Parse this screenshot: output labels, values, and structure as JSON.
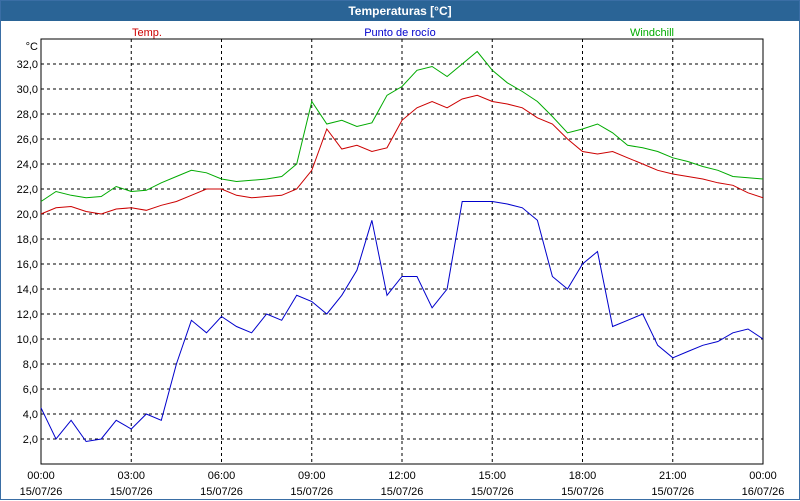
{
  "window": {
    "title": "Temperaturas [°C]"
  },
  "chart_data": {
    "type": "line",
    "unit_label": "°C",
    "ylim": [
      0,
      34
    ],
    "y_ticks": [
      "2,0",
      "4,0",
      "6,0",
      "8,0",
      "10,0",
      "12,0",
      "14,0",
      "16,0",
      "18,0",
      "20,0",
      "22,0",
      "24,0",
      "26,0",
      "28,0",
      "30,0",
      "32,0"
    ],
    "x_ticks": [
      {
        "time": "00:00",
        "date": "15/07/26"
      },
      {
        "time": "03:00",
        "date": "15/07/26"
      },
      {
        "time": "06:00",
        "date": "15/07/26"
      },
      {
        "time": "09:00",
        "date": "15/07/26"
      },
      {
        "time": "12:00",
        "date": "15/07/26"
      },
      {
        "time": "15:00",
        "date": "15/07/26"
      },
      {
        "time": "18:00",
        "date": "15/07/26"
      },
      {
        "time": "21:00",
        "date": "15/07/26"
      },
      {
        "time": "00:00",
        "date": "16/07/26"
      }
    ],
    "grid": true,
    "x": [
      0,
      0.5,
      1,
      1.5,
      2,
      2.5,
      3,
      3.5,
      4,
      4.5,
      5,
      5.5,
      6,
      6.5,
      7,
      7.5,
      8,
      8.5,
      9,
      9.5,
      10,
      10.5,
      11,
      11.5,
      12,
      12.5,
      13,
      13.5,
      14,
      14.5,
      15,
      15.5,
      16,
      16.5,
      17,
      17.5,
      18,
      18.5,
      19,
      19.5,
      20,
      20.5,
      21,
      21.5,
      22,
      22.5,
      23,
      23.5,
      24
    ],
    "series": [
      {
        "name": "Temp.",
        "color": "#cc0000",
        "values": [
          20.0,
          20.5,
          20.6,
          20.2,
          20.0,
          20.4,
          20.5,
          20.3,
          20.7,
          21.0,
          21.5,
          22.0,
          22.0,
          21.5,
          21.3,
          21.4,
          21.5,
          22.0,
          23.5,
          26.8,
          25.2,
          25.5,
          25.0,
          25.3,
          27.5,
          28.5,
          29.0,
          28.5,
          29.2,
          29.5,
          29.0,
          28.8,
          28.5,
          27.7,
          27.2,
          26.0,
          25.0,
          24.8,
          25.0,
          24.5,
          24.0,
          23.5,
          23.2,
          23.0,
          22.8,
          22.5,
          22.3,
          21.7,
          21.3
        ]
      },
      {
        "name": "Punto de rocío",
        "color": "#0000cc",
        "values": [
          4.5,
          2.0,
          3.5,
          1.8,
          2.0,
          3.5,
          2.8,
          4.0,
          3.5,
          8.0,
          11.5,
          10.5,
          11.8,
          11.0,
          10.5,
          12.0,
          11.5,
          13.5,
          13.0,
          12.0,
          13.5,
          15.5,
          19.5,
          13.5,
          15.0,
          15.0,
          12.5,
          14.0,
          21.0,
          21.0,
          21.0,
          20.8,
          20.5,
          19.5,
          15.0,
          14.0,
          16.0,
          17.0,
          11.0,
          11.5,
          12.0,
          9.5,
          8.5,
          9.0,
          9.5,
          9.8,
          10.5,
          10.8,
          10.0
        ]
      },
      {
        "name": "Windchill",
        "color": "#00aa00",
        "values": [
          21.0,
          21.8,
          21.5,
          21.3,
          21.4,
          22.2,
          21.8,
          21.9,
          22.5,
          23.0,
          23.5,
          23.3,
          22.8,
          22.6,
          22.7,
          22.8,
          23.0,
          24.0,
          29.0,
          27.2,
          27.5,
          27.0,
          27.3,
          29.5,
          30.2,
          31.5,
          31.8,
          31.0,
          32.0,
          33.0,
          31.5,
          30.5,
          29.8,
          29.0,
          27.8,
          26.5,
          26.8,
          27.2,
          26.5,
          25.5,
          25.3,
          25.0,
          24.5,
          24.2,
          23.8,
          23.5,
          23.0,
          22.9,
          22.8
        ]
      }
    ]
  }
}
